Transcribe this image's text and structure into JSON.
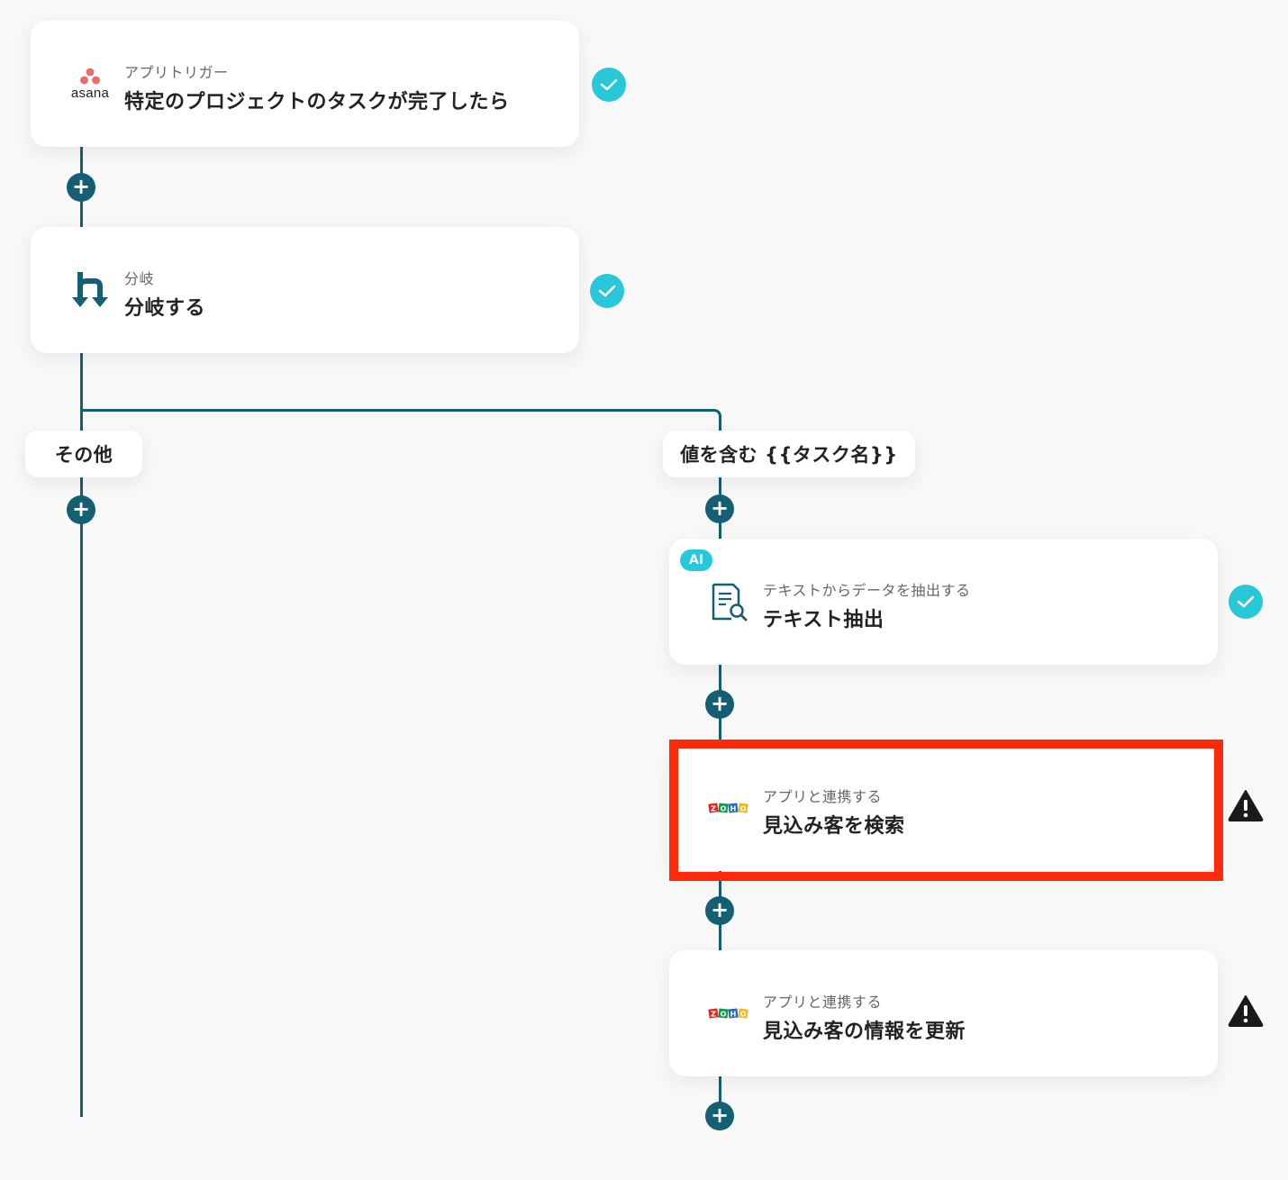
{
  "flow": {
    "trigger": {
      "icon": "asana-logo-icon",
      "logo_text": "asana",
      "subtitle": "アプリトリガー",
      "title": "特定のプロジェクトのタスクが完了したら",
      "status": "complete"
    },
    "branch_step": {
      "icon": "branch-icon",
      "subtitle": "分岐",
      "title": "分岐する",
      "status": "complete"
    },
    "branches": {
      "left": {
        "label": "その他"
      },
      "right": {
        "label": "値を含む {{タスク名}}"
      }
    },
    "extract_step": {
      "badge": "AI",
      "icon": "document-search-icon",
      "subtitle": "テキストからデータを抽出する",
      "title": "テキスト抽出",
      "status": "complete"
    },
    "search_step": {
      "icon": "zoho-logo-icon",
      "subtitle": "アプリと連携する",
      "title": "見込み客を検索",
      "status": "warning"
    },
    "update_step": {
      "icon": "zoho-logo-icon",
      "subtitle": "アプリと連携する",
      "title": "見込み客の情報を更新",
      "status": "warning"
    },
    "add_button_symbol": "+"
  },
  "colors": {
    "line": "#145f73",
    "check": "#28c8d8",
    "warning": "#1a1a1a",
    "highlight": "#ff2a0a"
  }
}
